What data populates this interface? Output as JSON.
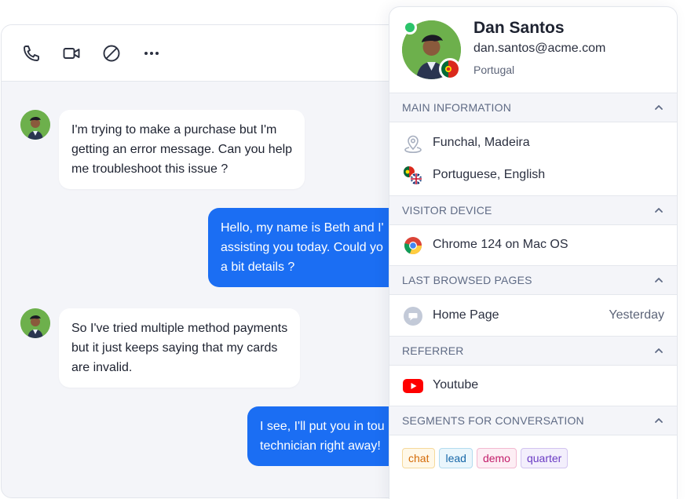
{
  "toolbar": {
    "icons": [
      "phone-icon",
      "video-icon",
      "block-icon",
      "more-icon"
    ]
  },
  "messages": [
    {
      "from": "visitor",
      "lines": [
        "I'm trying to make a purchase but I'm",
        "getting an error message. Can you help",
        "me troubleshoot this issue ?"
      ]
    },
    {
      "from": "agent",
      "lines": [
        "Hello, my name is Beth and I'",
        "assisting you today. Could yo",
        "a bit details ?"
      ]
    },
    {
      "from": "visitor",
      "lines": [
        "So I've tried multiple method payments",
        "but it just keeps saying that my cards",
        "are invalid."
      ]
    },
    {
      "from": "agent",
      "lines": [
        "I see, I'll put you in tou",
        "technician right away!"
      ]
    }
  ],
  "contact": {
    "name": "Dan Santos",
    "email": "dan.santos@acme.com",
    "country": "Portugal",
    "status_color": "#2bc46b"
  },
  "sections": {
    "main": {
      "title": "MAIN INFORMATION",
      "location": "Funchal, Madeira",
      "languages": "Portuguese, English"
    },
    "device": {
      "title": "VISITOR DEVICE",
      "browser": "Chrome 124 on Mac OS"
    },
    "pages": {
      "title": "LAST BROWSED PAGES",
      "page": "Home Page",
      "when": "Yesterday"
    },
    "referrer": {
      "title": "REFERRER",
      "source": "Youtube"
    },
    "segments": {
      "title": "SEGMENTS FOR CONVERSATION",
      "tags": [
        "chat",
        "lead",
        "demo",
        "quarter"
      ]
    }
  },
  "colors": {
    "accent": "#1b6ef3",
    "avatar_bg": "#6db04c"
  }
}
